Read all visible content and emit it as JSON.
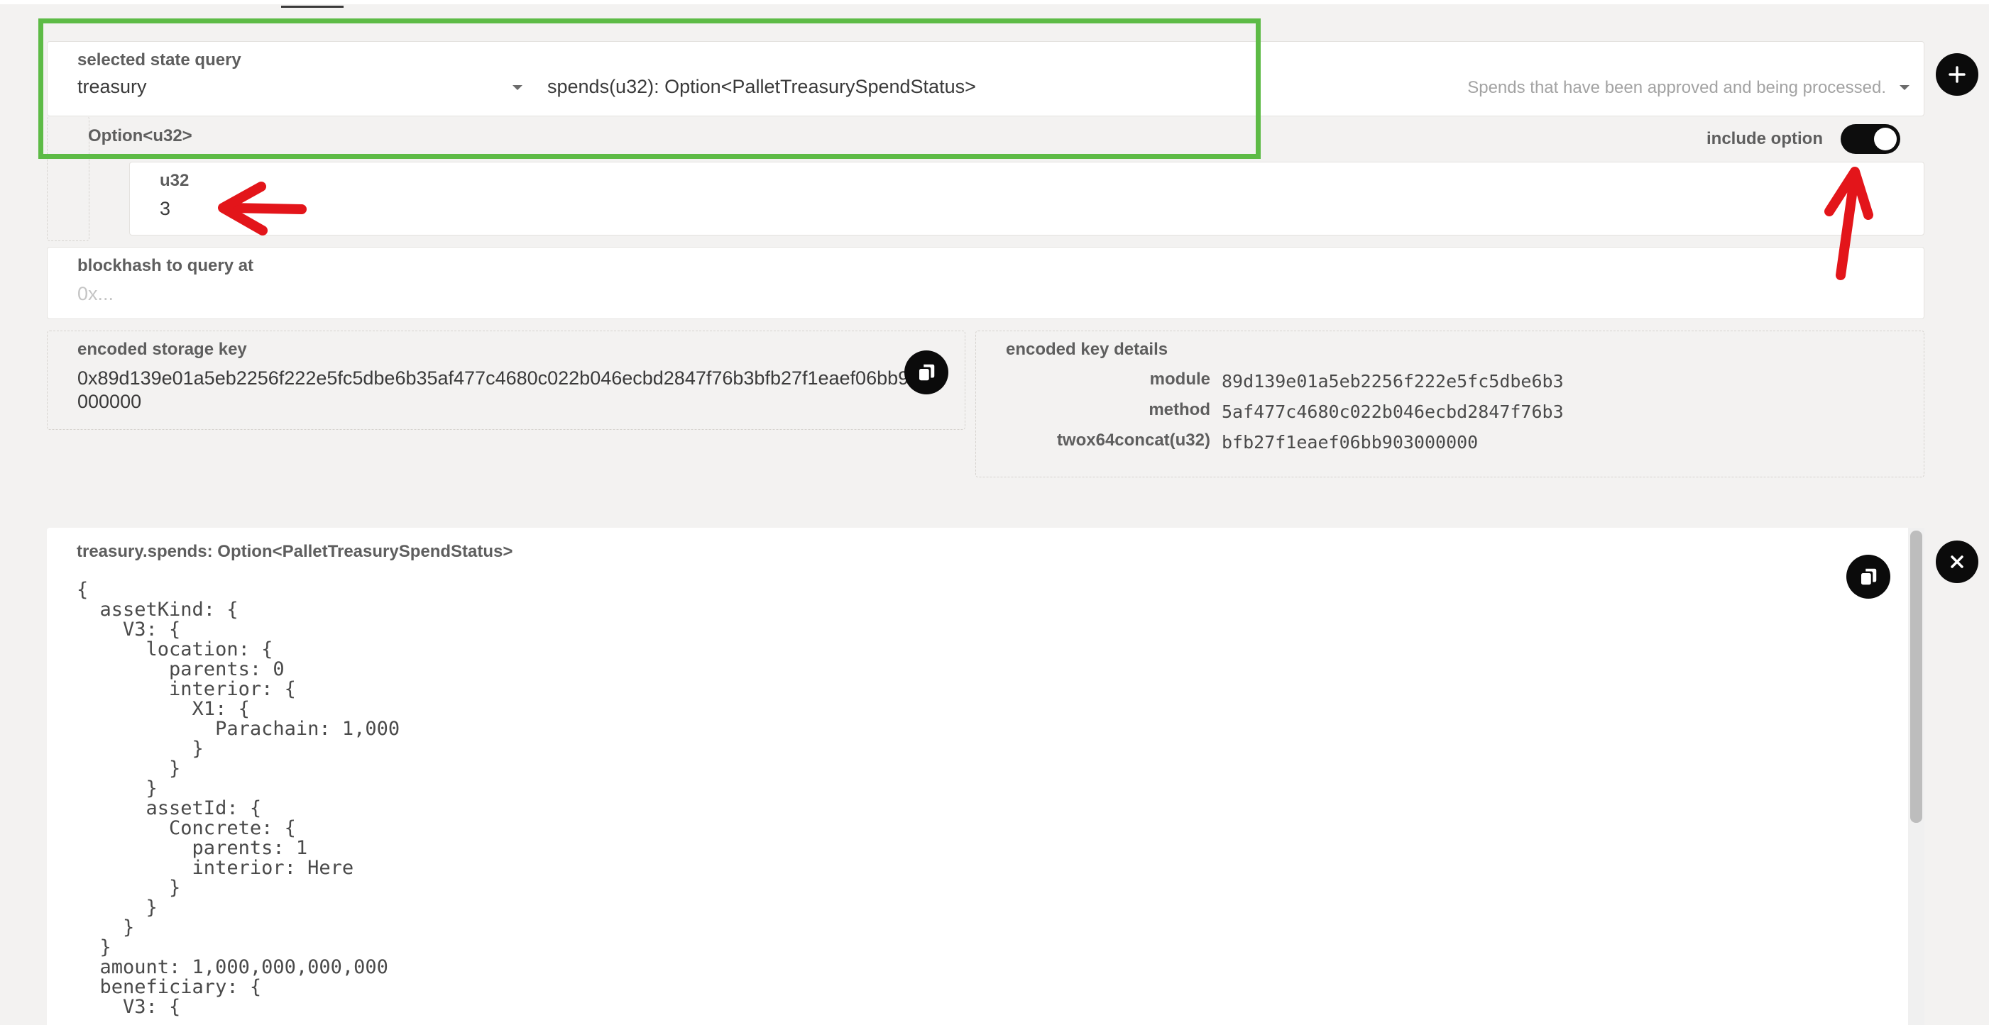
{
  "query": {
    "section_label": "selected state query",
    "pallet": "treasury",
    "method": "spends(u32): Option<PalletTreasurySpendStatus>",
    "description": "Spends that have been approved and being processed."
  },
  "param": {
    "option_label": "Option<u32>",
    "include_option_label": "include option",
    "include_option_enabled": true,
    "type_label": "u32",
    "value": "3"
  },
  "blockhash": {
    "label": "blockhash to query at",
    "placeholder": "0x..."
  },
  "encoded_key": {
    "label": "encoded storage key",
    "value": "0x89d139e01a5eb2256f222e5fc5dbe6b35af477c4680c022b046ecbd2847f76b3bfb27f1eaef06bb903000000"
  },
  "key_details": {
    "label": "encoded key details",
    "module_label": "module",
    "module_value": "89d139e01a5eb2256f222e5fc5dbe6b3",
    "method_label": "method",
    "method_value": "5af477c4680c022b046ecbd2847f76b3",
    "hasher_label": "twox64concat(u32)",
    "hasher_value": "bfb27f1eaef06bb903000000"
  },
  "result": {
    "title": "treasury.spends: Option<PalletTreasurySpendStatus>",
    "body": "{\n  assetKind: {\n    V3: {\n      location: {\n        parents: 0\n        interior: {\n          X1: {\n            Parachain: 1,000\n          }\n        }\n      }\n      assetId: {\n        Concrete: {\n          parents: 1\n          interior: Here\n        }\n      }\n    }\n  }\n  amount: 1,000,000,000,000\n  beneficiary: {\n    V3: {"
  },
  "icons": {
    "add": "plus-icon",
    "close": "close-icon",
    "copy": "copy-icon",
    "dropdown": "chevron-down-icon"
  },
  "colors": {
    "highlight_box": "#5dbb46",
    "annotation_arrow": "#e3151a",
    "toggle_on": "#0d0d0d"
  }
}
